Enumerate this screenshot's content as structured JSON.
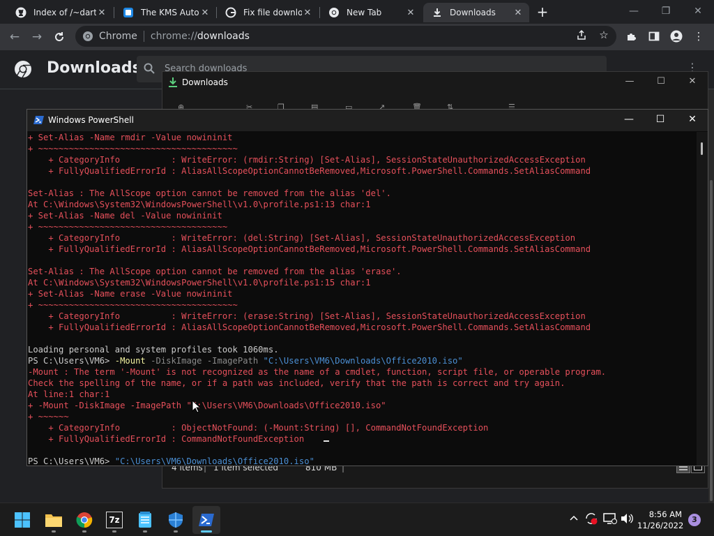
{
  "browser": {
    "tabs": [
      {
        "title": "Index of /~dartz",
        "icon": "github-icon",
        "active": false
      },
      {
        "title": "The KMS Auto N",
        "icon": "kms-icon",
        "active": false
      },
      {
        "title": "Fix file downloa",
        "icon": "google-icon",
        "active": false
      },
      {
        "title": "New Tab",
        "icon": "chrome-icon",
        "active": false
      },
      {
        "title": "Downloads",
        "icon": "download-icon",
        "active": true
      }
    ],
    "address": {
      "chip": "Chrome",
      "scheme": "chrome://",
      "host": "downloads"
    }
  },
  "downloads_page": {
    "title": "Downloads",
    "search_placeholder": "Search downloads"
  },
  "explorer": {
    "title": "Downloads",
    "status": {
      "items": "4 items",
      "selected": "1 item selected",
      "size": "810 MB"
    }
  },
  "powershell": {
    "title": "Windows PowerShell",
    "lines": [
      [
        {
          "t": "+ Set-Alias -Name rmdir -Value nowininit",
          "c": "err"
        }
      ],
      [
        {
          "t": "+ ~~~~~~~~~~~~~~~~~~~~~~~~~~~~~~~~~~~~~~~",
          "c": "err"
        }
      ],
      [
        {
          "t": "    + CategoryInfo          : WriteError: (rmdir:String) [Set-Alias], SessionStateUnauthorizedAccessException",
          "c": "err"
        }
      ],
      [
        {
          "t": "    + FullyQualifiedErrorId : AliasAllScopeOptionCannotBeRemoved,Microsoft.PowerShell.Commands.SetAliasCommand",
          "c": "err"
        }
      ],
      [
        {
          "t": "",
          "c": "err"
        }
      ],
      [
        {
          "t": "Set-Alias : The AllScope option cannot be removed from the alias 'del'.",
          "c": "err"
        }
      ],
      [
        {
          "t": "At C:\\Windows\\System32\\WindowsPowerShell\\v1.0\\profile.ps1:13 char:1",
          "c": "err"
        }
      ],
      [
        {
          "t": "+ Set-Alias -Name del -Value nowininit",
          "c": "err"
        }
      ],
      [
        {
          "t": "+ ~~~~~~~~~~~~~~~~~~~~~~~~~~~~~~~~~~~~~",
          "c": "err"
        }
      ],
      [
        {
          "t": "    + CategoryInfo          : WriteError: (del:String) [Set-Alias], SessionStateUnauthorizedAccessException",
          "c": "err"
        }
      ],
      [
        {
          "t": "    + FullyQualifiedErrorId : AliasAllScopeOptionCannotBeRemoved,Microsoft.PowerShell.Commands.SetAliasCommand",
          "c": "err"
        }
      ],
      [
        {
          "t": "",
          "c": "err"
        }
      ],
      [
        {
          "t": "Set-Alias : The AllScope option cannot be removed from the alias 'erase'.",
          "c": "err"
        }
      ],
      [
        {
          "t": "At C:\\Windows\\System32\\WindowsPowerShell\\v1.0\\profile.ps1:15 char:1",
          "c": "err"
        }
      ],
      [
        {
          "t": "+ Set-Alias -Name erase -Value nowininit",
          "c": "err"
        }
      ],
      [
        {
          "t": "+ ~~~~~~~~~~~~~~~~~~~~~~~~~~~~~~~~~~~~~~~",
          "c": "err"
        }
      ],
      [
        {
          "t": "    + CategoryInfo          : WriteError: (erase:String) [Set-Alias], SessionStateUnauthorizedAccessException",
          "c": "err"
        }
      ],
      [
        {
          "t": "    + FullyQualifiedErrorId : AliasAllScopeOptionCannotBeRemoved,Microsoft.PowerShell.Commands.SetAliasCommand",
          "c": "err"
        }
      ],
      [
        {
          "t": "",
          "c": "out"
        }
      ],
      [
        {
          "t": "Loading personal and system profiles took 1060ms.",
          "c": "out"
        }
      ],
      [
        {
          "t": "PS C:\\Users\\VM6> ",
          "c": "out"
        },
        {
          "t": "-Mount",
          "c": "cmd"
        },
        {
          "t": " -DiskImage -ImagePath ",
          "c": "par"
        },
        {
          "t": "\"C:\\Users\\VM6\\Downloads\\Office2010.iso\"",
          "c": "str"
        }
      ],
      [
        {
          "t": "-Mount : The term '-Mount' is not recognized as the name of a cmdlet, function, script file, or operable program.",
          "c": "err"
        }
      ],
      [
        {
          "t": "Check the spelling of the name, or if a path was included, verify that the path is correct and try again.",
          "c": "err"
        }
      ],
      [
        {
          "t": "At line:1 char:1",
          "c": "err"
        }
      ],
      [
        {
          "t": "+ -Mount -DiskImage -ImagePath \"C:\\Users\\VM6\\Downloads\\Office2010.iso\"",
          "c": "err"
        }
      ],
      [
        {
          "t": "+ ~~~~~~",
          "c": "err"
        }
      ],
      [
        {
          "t": "    + CategoryInfo          : ObjectNotFound: (-Mount:String) [], CommandNotFoundException",
          "c": "err"
        }
      ],
      [
        {
          "t": "    + FullyQualifiedErrorId : CommandNotFoundException",
          "c": "err"
        }
      ],
      [
        {
          "t": "",
          "c": "out"
        }
      ],
      [
        {
          "t": "PS C:\\Users\\VM6> ",
          "c": "out"
        },
        {
          "t": "\"C:\\Users\\VM6\\Downloads\\Office2010.iso\"",
          "c": "str"
        }
      ]
    ]
  },
  "taskbar": {
    "apps": [
      {
        "name": "start-button",
        "icon": "windows-logo-icon"
      },
      {
        "name": "file-explorer-app",
        "icon": "folder-icon"
      },
      {
        "name": "chrome-app",
        "icon": "chrome-icon"
      },
      {
        "name": "7zip-app",
        "icon": "7z-icon",
        "label": "7z"
      },
      {
        "name": "notepad-app",
        "icon": "notepad-icon"
      },
      {
        "name": "defender-app",
        "icon": "shield-icon"
      },
      {
        "name": "powershell-app",
        "icon": "powershell-icon"
      }
    ],
    "clock": {
      "time": "8:56 AM",
      "date": "11/26/2022"
    },
    "notification_count": "3"
  },
  "colors": {
    "error": "#e6505b",
    "command": "#f2f2a0",
    "string": "#4b8fd4",
    "accent": "#60cdff"
  }
}
